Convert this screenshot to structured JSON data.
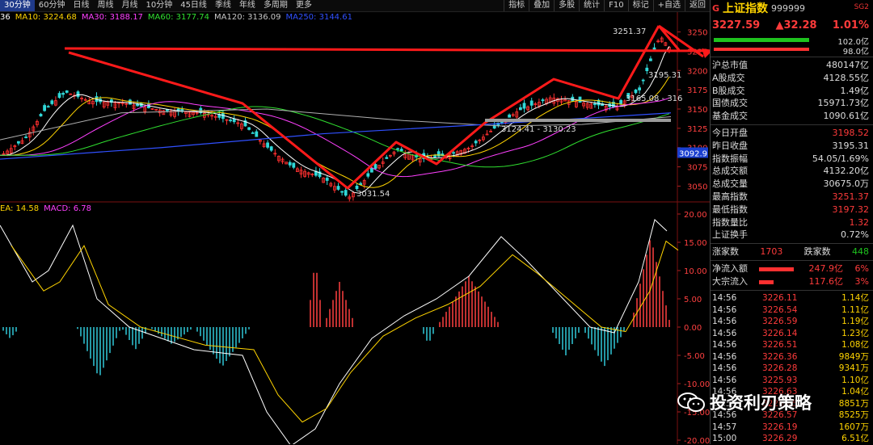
{
  "toolbar": {
    "periods": [
      "30分钟",
      "60分钟",
      "日线",
      "周线",
      "月线",
      "10分钟",
      "45日线",
      "季线",
      "年线",
      "多周期",
      "更多"
    ],
    "active_index": 0,
    "right_items": [
      "指标",
      "叠加",
      "多股",
      "统计",
      "F10",
      "标记",
      "+自选",
      "返回"
    ]
  },
  "ma_legend": [
    {
      "label": "36",
      "color": "#ffffff"
    },
    {
      "label": "MA10: 3224.68",
      "color": "#ffd400"
    },
    {
      "label": "MA30: 3188.17",
      "color": "#ff40ff"
    },
    {
      "label": "MA60: 3177.74",
      "color": "#30e030"
    },
    {
      "label": "MA120: 3136.09",
      "color": "#c8c8c8"
    },
    {
      "label": "MA250: 3144.61",
      "color": "#3050ff"
    }
  ],
  "macd_legend": [
    {
      "label": "EA: 14.58",
      "color": "#ffd400"
    },
    {
      "label": "MACD: 6.78",
      "color": "#ff40ff"
    }
  ],
  "price_axis": [
    "3250",
    "3225",
    "3200",
    "3175",
    "3150",
    "3125",
    "3100",
    "3075",
    "3050"
  ],
  "price_tag": "3092.9",
  "macd_axis": [
    "20.00",
    "15.00",
    "10.00",
    "5.00",
    "0.00",
    "-5.00",
    "-10.00",
    "-15.00",
    "-20.00"
  ],
  "annotations": {
    "high": "3251.37",
    "low": "3031.54",
    "support": "3124.41 - 3130.23",
    "right1": "3195.31",
    "right2": "3165.08 - 316"
  },
  "chart_data": {
    "type": "candlestick",
    "timeframe": "30分钟",
    "ylim": [
      3040,
      3260
    ],
    "key_points": {
      "high": 3251.37,
      "low": 3031.54
    },
    "macd": {
      "DEA": 14.58,
      "MACD": 6.78,
      "ylim": [
        -20,
        20
      ]
    }
  },
  "panel": {
    "flag": "G",
    "name": "上证指数",
    "code": "999999",
    "badge": "SG2",
    "price": "3227.59",
    "change": "▲32.28",
    "pct": "1.01%",
    "bar_top": "102.0亿",
    "bar_bottom": "98.0亿",
    "stats1": [
      {
        "k": "沪总市值",
        "v": "480147亿",
        "c": ""
      },
      {
        "k": "A股成交",
        "v": "4128.55亿",
        "c": ""
      },
      {
        "k": "B股成交",
        "v": "1.49亿",
        "c": ""
      },
      {
        "k": "国债成交",
        "v": "15971.73亿",
        "c": ""
      },
      {
        "k": "基金成交",
        "v": "1090.61亿",
        "c": ""
      }
    ],
    "stats2": [
      {
        "k": "今日开盘",
        "v": "3198.52",
        "c": "red"
      },
      {
        "k": "昨日收盘",
        "v": "3195.31",
        "c": ""
      },
      {
        "k": "指数振幅",
        "v": "54.05/1.69%",
        "c": ""
      },
      {
        "k": "总成交额",
        "v": "4132.20亿",
        "c": ""
      },
      {
        "k": "总成交量",
        "v": "30675.0万",
        "c": ""
      },
      {
        "k": "最高指数",
        "v": "3251.37",
        "c": "red"
      },
      {
        "k": "最低指数",
        "v": "3197.32",
        "c": "red"
      },
      {
        "k": "指数量比",
        "v": "1.32",
        "c": "red"
      },
      {
        "k": "上证换手",
        "v": "0.72%",
        "c": ""
      }
    ],
    "up_label": "涨家数",
    "up_value": "1703",
    "down_label": "跌家数",
    "down_value": "448",
    "flows": [
      {
        "k": "净流入额",
        "amt": "247.9亿",
        "pct": "6%",
        "level": 0.78
      },
      {
        "k": "大宗流入",
        "amt": "117.6亿",
        "pct": "3%",
        "level": 0.33
      }
    ],
    "ticks": [
      {
        "t": "14:56",
        "p": "3226.11",
        "v": "1.14亿"
      },
      {
        "t": "14:56",
        "p": "3226.54",
        "v": "1.11亿"
      },
      {
        "t": "14:56",
        "p": "3226.59",
        "v": "1.19亿"
      },
      {
        "t": "14:56",
        "p": "3226.14",
        "v": "1.23亿"
      },
      {
        "t": "14:56",
        "p": "3226.51",
        "v": "1.08亿"
      },
      {
        "t": "14:56",
        "p": "3226.36",
        "v": "9849万"
      },
      {
        "t": "14:56",
        "p": "3226.28",
        "v": "9341万"
      },
      {
        "t": "14:56",
        "p": "3225.93",
        "v": "1.10亿"
      },
      {
        "t": "14:56",
        "p": "3226.63",
        "v": "1.04亿"
      },
      {
        "t": "14:56",
        "p": "3226.45",
        "v": "8851万"
      },
      {
        "t": "14:56",
        "p": "3226.57",
        "v": "8525万"
      },
      {
        "t": "14:57",
        "p": "3226.19",
        "v": "1607万"
      },
      {
        "t": "15:00",
        "p": "3226.29",
        "v": "6.51亿"
      }
    ]
  },
  "watermark": "投资利刃策略"
}
